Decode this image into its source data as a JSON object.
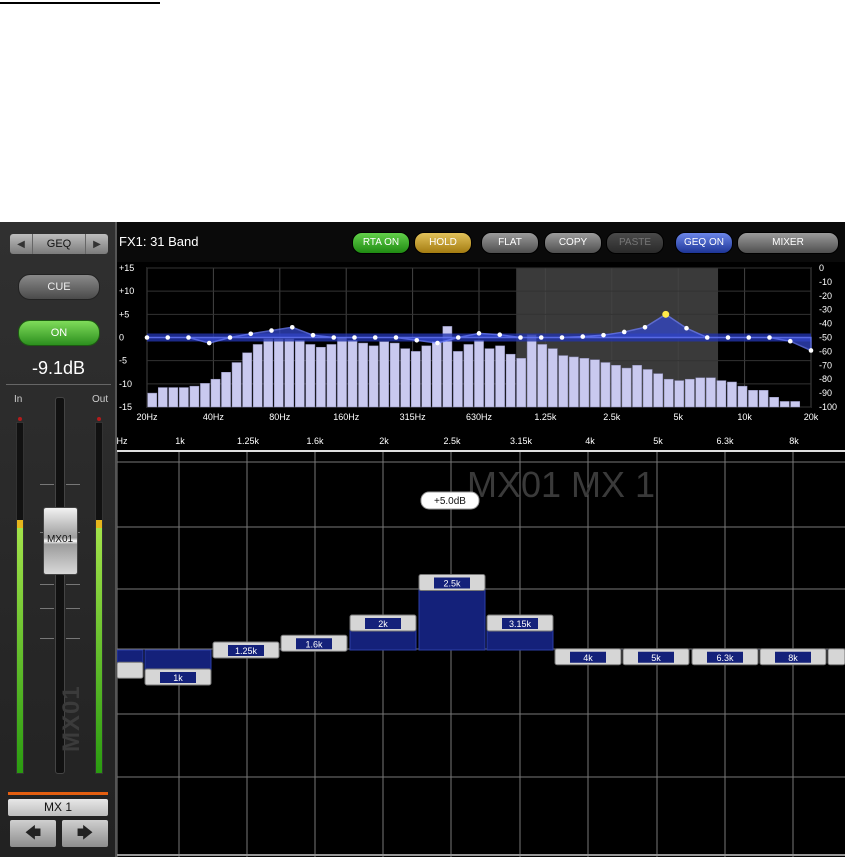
{
  "strip": {
    "nav_label": "GEQ",
    "cue_label": "CUE",
    "on_label": "ON",
    "level": "-9.1dB",
    "in_label": "In",
    "out_label": "Out",
    "fader_label": "MX01",
    "vertical_name": "MX01",
    "channel_name": "MX 1",
    "accent_color": "#e35e10"
  },
  "toolbar": {
    "title": "FX1: 31 Band",
    "rta_on": "RTA ON",
    "hold": "HOLD",
    "flat": "FLAT",
    "copy": "COPY",
    "paste": "PASTE",
    "geq_on": "GEQ ON",
    "mixer": "MIXER"
  },
  "analyzer": {
    "left_scale": [
      "+15",
      "+10",
      "+5",
      "0",
      "-5",
      "-10",
      "-15"
    ],
    "right_scale": [
      "0",
      "-10",
      "-20",
      "-30",
      "-40",
      "-50",
      "-60",
      "-70",
      "-80",
      "-90",
      "-100"
    ],
    "freq_labels": [
      "20Hz",
      "40Hz",
      "80Hz",
      "160Hz",
      "315Hz",
      "630Hz",
      "1.25k",
      "2.5k",
      "5k",
      "10k",
      "20k"
    ],
    "bars_db": [
      -90,
      -86,
      -86,
      -86,
      -85,
      -83,
      -80,
      -75,
      -68,
      -61,
      -55,
      -51,
      -51,
      -51,
      -52,
      -55,
      -57,
      -55,
      -50,
      -52,
      -54,
      -56,
      -53,
      -54,
      -58,
      -60,
      -56,
      -53,
      -42,
      -60,
      -55,
      -52,
      -58,
      -56,
      -62,
      -65,
      -48,
      -55,
      -58,
      -63,
      -64,
      -65,
      -66,
      -68,
      -70,
      -72,
      -70,
      -73,
      -76,
      -80,
      -81,
      -80,
      -79,
      -79,
      -81,
      -82,
      -85,
      -88,
      -88,
      -93,
      -96,
      -96,
      -100
    ],
    "geq_points_db": [
      0,
      0,
      0,
      -1.2,
      0,
      0.8,
      1.5,
      2.2,
      0.5,
      0,
      0,
      0,
      0,
      -0.6,
      -1.2,
      0,
      0.9,
      0.6,
      0,
      0,
      0,
      0.2,
      0.5,
      1.2,
      2.2,
      5,
      2,
      0,
      0,
      0,
      0,
      -0.8,
      -2.8
    ],
    "highlight_range": [
      "1.25k",
      "8k"
    ]
  },
  "band_strip": {
    "labels": [
      "1k",
      "1.25k",
      "1.6k",
      "2k",
      "2.5k",
      "3.15k",
      "4k",
      "5k",
      "6.3k",
      "8k"
    ],
    "gains_db": [
      -2,
      -1,
      0,
      0.5,
      2.5,
      5,
      2.5,
      0,
      -0.5,
      -0.5,
      -0.5,
      -0.5
    ],
    "tooltip": "+5.0dB",
    "watermark": "MX01 MX 1"
  },
  "colors": {
    "blue": "#1d3597",
    "green": "#2c8f1e",
    "gold": "#a47c11"
  }
}
